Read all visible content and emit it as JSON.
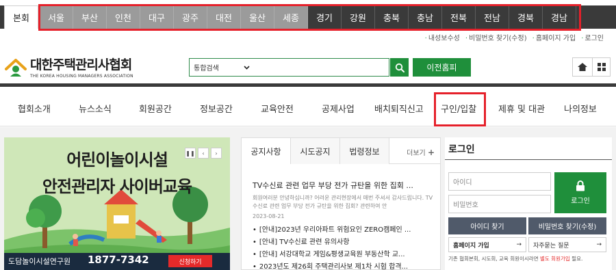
{
  "region_tabs": {
    "home": "본회",
    "items": [
      "서울",
      "부산",
      "인천",
      "대구",
      "광주",
      "대전",
      "울산",
      "세종",
      "경기",
      "강원",
      "충북",
      "충남",
      "전북",
      "전남",
      "경북",
      "경남"
    ]
  },
  "utility_links": [
    "내성보수성",
    "비밀번호 찾기(수정)",
    "홈페이지 가입",
    "로그인"
  ],
  "logo": {
    "korean": "대한주택관리사협회",
    "english": "THE KOREA HOUSING MANAGERS ASSOCIATION"
  },
  "search": {
    "select_value": "통합검색",
    "shortcut_label": "이전홈피"
  },
  "nav": [
    "협회소개",
    "뉴스소식",
    "회원공간",
    "정보공간",
    "교육안전",
    "공제사업",
    "배치퇴직신고",
    "구인/입찰",
    "제휴 및 대관",
    "나의정보"
  ],
  "banner": {
    "line1": "어린이놀이시설",
    "line2": "안전관리자 사이버교육",
    "org": "도담놀이시설연구원",
    "phone": "1877-7342",
    "apply": "신청하기"
  },
  "notice": {
    "tabs": [
      "공지사항",
      "시도공지",
      "법령정보"
    ],
    "more": "더보기",
    "featured_title": "TV수신료 관련 업무 부당 전가 규탄을 위한 집회 ...",
    "featured_body": "회원여러분 안녕하십니까? 어려운 관리현장에서 매번 주셔서 감사드립니다. TV수신료 관련 업무 부당 전가 규탄을 위한 집회? 관련하여 안",
    "featured_date": "2023-08-21",
    "items": [
      "[안내]2023년 우리아파트 위험요인 ZERO캠페인 ...",
      "[안내] TV수신료 관련 유의사항",
      "[안내] 서강대학교 게임&평생교육원 부동산학 교...",
      "2023년도 제26회 주택관리사보 제1차 시험 합격..."
    ]
  },
  "login": {
    "title": "로그인",
    "id_placeholder": "아이디",
    "pw_placeholder": "비밀번호",
    "button": "로그인",
    "find_id": "아이디 찾기",
    "find_pw": "비밀번호 찾기(수정)",
    "join": "홈페이지 가입",
    "faq": "자주묻는 질문",
    "note_prefix": "기존 협회본회, 시도회, 교육 회원이시라면 ",
    "note_red": "별도 회원가입",
    "note_suffix": " 필요."
  },
  "colors": {
    "highlight_red": "#e5202a",
    "brand_green": "#1f8f3b",
    "region_dark": "#3a3a3a",
    "region_light": "#9b9b9b"
  }
}
